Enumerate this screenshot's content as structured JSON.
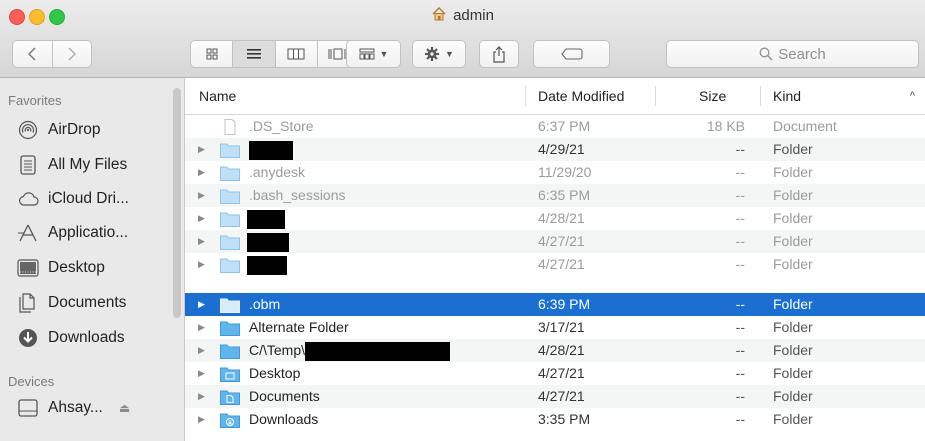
{
  "window": {
    "title": "admin"
  },
  "toolbar": {
    "back_icon": "chevron-left-icon",
    "forward_icon": "chevron-right-icon",
    "search_placeholder": "Search"
  },
  "sidebar": {
    "favorites_header": "Favorites",
    "favorites": [
      {
        "label": "AirDrop",
        "icon": "airdrop-icon"
      },
      {
        "label": "All My Files",
        "icon": "all-files-icon"
      },
      {
        "label": "iCloud Dri...",
        "icon": "cloud-icon"
      },
      {
        "label": "Applicatio...",
        "icon": "applications-icon"
      },
      {
        "label": "Desktop",
        "icon": "desktop-icon"
      },
      {
        "label": "Documents",
        "icon": "documents-icon"
      },
      {
        "label": "Downloads",
        "icon": "downloads-icon"
      }
    ],
    "devices_header": "Devices",
    "devices": [
      {
        "label": "Ahsay...",
        "icon": "drive-icon",
        "eject": "⏏"
      }
    ]
  },
  "columns": {
    "name": "Name",
    "date": "Date Modified",
    "size": "Size",
    "kind": "Kind"
  },
  "files": [
    {
      "name": ".DS_Store",
      "date": "6:37 PM",
      "size": "18 KB",
      "kind": "Document"
    },
    {
      "name": "",
      "date": "4/29/21",
      "size": "--",
      "kind": "Folder"
    },
    {
      "name": ".anydesk",
      "date": "11/29/20",
      "size": "--",
      "kind": "Folder"
    },
    {
      "name": ".bash_sessions",
      "date": "6:35 PM",
      "size": "--",
      "kind": "Folder"
    },
    {
      "name": "",
      "date": "4/28/21",
      "size": "--",
      "kind": "Folder"
    },
    {
      "name": "",
      "date": "4/27/21",
      "size": "--",
      "kind": "Folder"
    },
    {
      "name": "",
      "date": "4/27/21",
      "size": "--",
      "kind": "Folder"
    },
    {
      "name": ".obm",
      "date": "6:39 PM",
      "size": "--",
      "kind": "Folder"
    },
    {
      "name": "Alternate Folder",
      "date": "3/17/21",
      "size": "--",
      "kind": "Folder"
    },
    {
      "name": "C/\\Temp\\",
      "date": "4/28/21",
      "size": "--",
      "kind": "Folder"
    },
    {
      "name": "Desktop",
      "date": "4/27/21",
      "size": "--",
      "kind": "Folder"
    },
    {
      "name": "Documents",
      "date": "4/27/21",
      "size": "--",
      "kind": "Folder"
    },
    {
      "name": "Downloads",
      "date": "3:35 PM",
      "size": "--",
      "kind": "Folder"
    }
  ],
  "colors": {
    "selection": "#1a6fd1",
    "folder": "#5fb5ec",
    "sidebar_bg": "#e9e9e9"
  }
}
